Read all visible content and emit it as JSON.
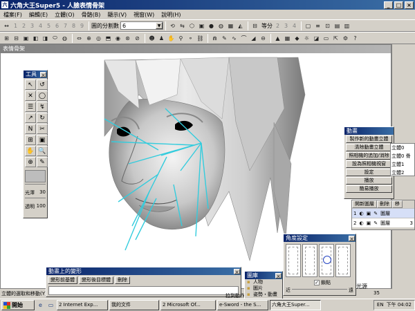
{
  "window": {
    "title": "六角大王Super5 - 人臉表情骨架",
    "app_icon": "六"
  },
  "menu": [
    "檔案(F)",
    "編輯(E)",
    "立體(O)",
    "骨骼(B)",
    "顯示(V)",
    "視窗(W)",
    "說明(H)"
  ],
  "toolbar1": {
    "numbers": [
      "1",
      "2",
      "3",
      "4",
      "5",
      "6",
      "7",
      "8",
      "9"
    ],
    "division_label": "圓的分割數",
    "division_value": "6",
    "equal_label": "等分",
    "equal_numbers": [
      "2",
      "3",
      "4"
    ]
  },
  "viewport": {
    "title": "表情骨架"
  },
  "tools": {
    "title": "工具",
    "icons": [
      "↖",
      "↺",
      "✕",
      "◯",
      "☰",
      "↯",
      "↗",
      "↻",
      "Ν",
      "✂",
      "⊞",
      "▣",
      "✋",
      "🔍",
      "⊕",
      "✎"
    ],
    "gloss_label": "光澤",
    "gloss_value": "30",
    "transparency_label": "透明",
    "transparency_value": "100"
  },
  "animation": {
    "title": "動畫",
    "buttons": [
      "製作新的動畫立體",
      "清除動畫立體",
      "照相機的追加/消除",
      "設為照相機視窗",
      "設定",
      "播放",
      "簡易播放"
    ]
  },
  "frames": [
    "立體0",
    "立體0 骨",
    "立體1",
    "立體2"
  ],
  "layers": {
    "headers": [
      "開新圖層",
      "刪除",
      "移"
    ],
    "rows": [
      {
        "index": "1",
        "name": "圖層",
        "value": ""
      },
      {
        "index": "2",
        "name": "圖層",
        "value": "3"
      }
    ]
  },
  "angle": {
    "title": "角度設定",
    "snap_label": "鎖點",
    "near_label": "近",
    "far_label": "遠"
  },
  "deform": {
    "title": "動畫上的變形",
    "buttons": [
      "變形前基體",
      "變形後目標體",
      "刪除"
    ]
  },
  "library": {
    "title": "圖庫",
    "items": [
      "人物",
      "圖片",
      "姿勢・動畫"
    ]
  },
  "light_label": "光源",
  "light_value": "35",
  "status_text": "立體的選取和移動(Y)",
  "status_text2": "拉到動作",
  "taskbar": {
    "start": "開始",
    "tasks": [
      "2 Internet Exp...",
      "我的文件",
      "2 Microsoft Of...",
      "e-Sword - the S...",
      "六角大王Super..."
    ],
    "tray_items": [
      "EN",
      "下午 04:02"
    ]
  },
  "colors": {
    "title_start": "#0a246a",
    "title_end": "#3a6ea5",
    "bones": "#33ccdd"
  }
}
